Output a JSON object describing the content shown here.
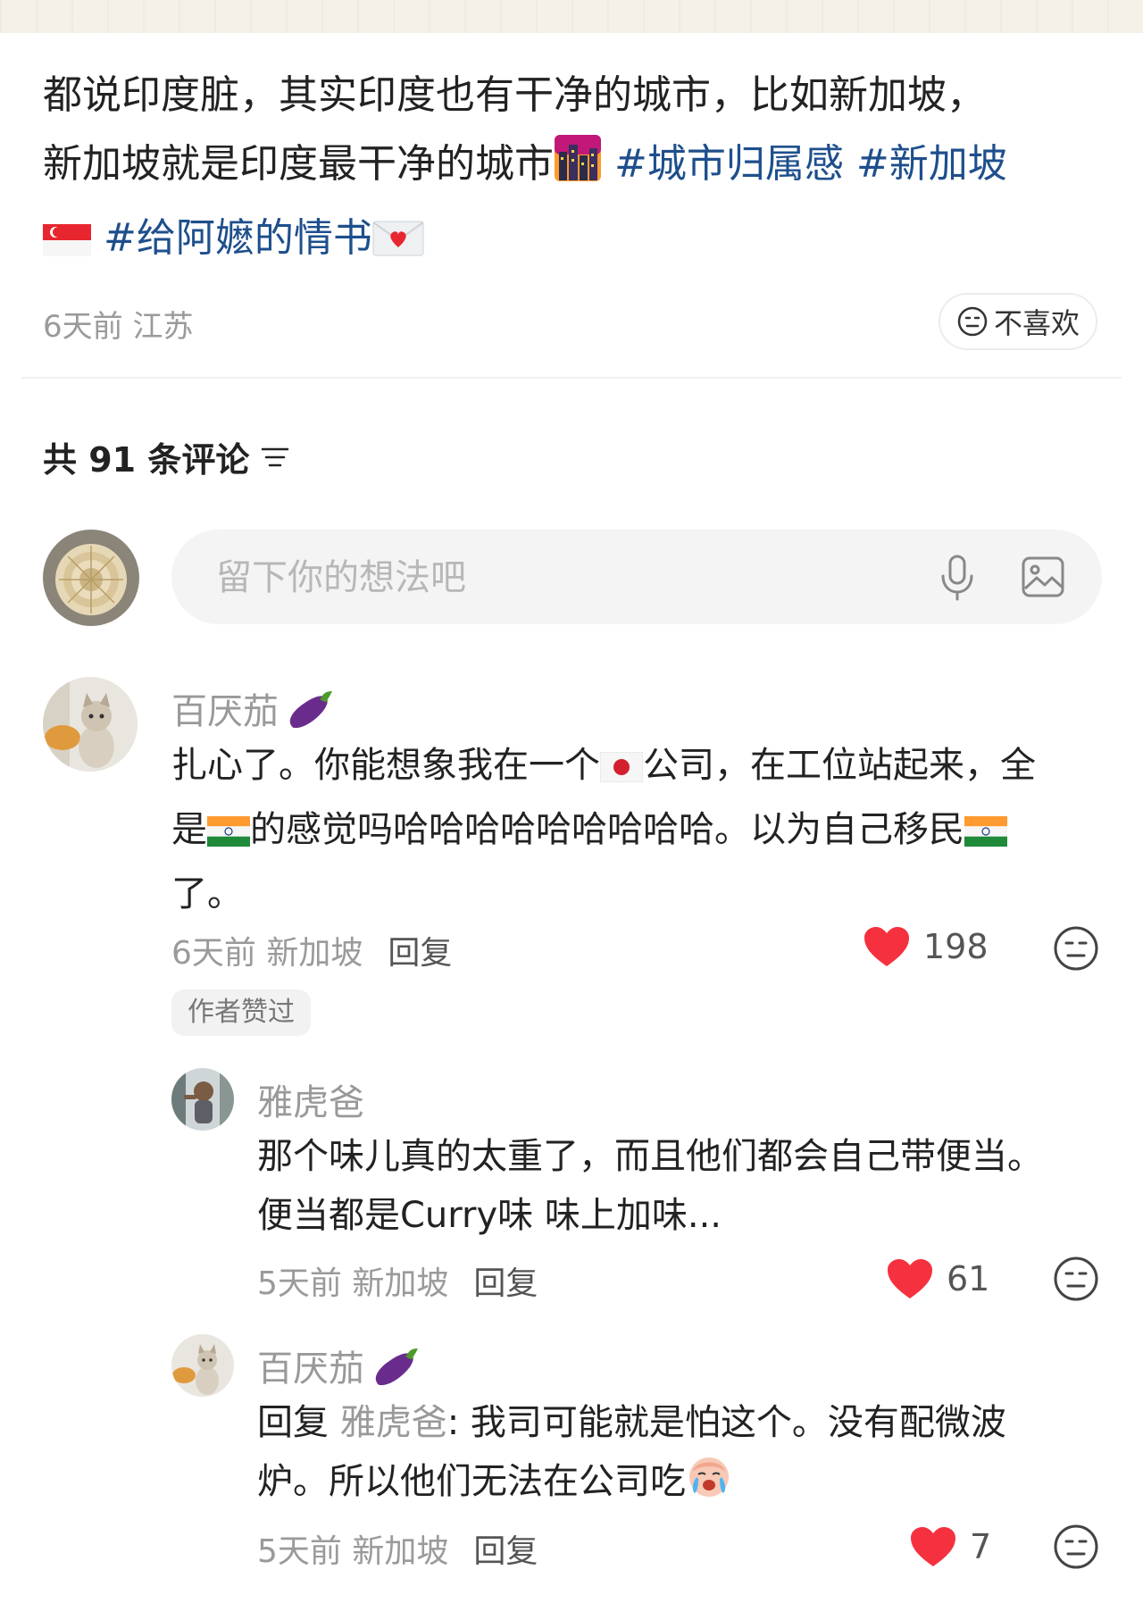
{
  "post": {
    "text_line1": "都说印度脏，其实印度也有干净的城市，比如新加坡，",
    "text_line2": "新加坡就是印度最干净的城市",
    "hashtags": [
      "#城市归属感",
      "#新加坡",
      "#给阿嬷的情书"
    ],
    "meta": "6天前 江苏",
    "dislike_label": "不喜欢"
  },
  "comments_header": {
    "count_label": "共 91 条评论"
  },
  "input": {
    "placeholder": "留下你的想法吧"
  },
  "comments": [
    {
      "username": "百厌茄",
      "text_a": "扎心了。你能想象我在一个",
      "text_b": "公司，在工位站起来，全",
      "text_c": "是",
      "text_d": "的感觉吗哈哈哈哈哈哈哈哈哈。以为自己移民",
      "text_e": "了。",
      "time_location": "6天前 新加坡",
      "reply_label": "回复",
      "likes": "198",
      "author_liked": "作者赞过"
    },
    {
      "username": "雅虎爸",
      "text_line1": "那个味儿真的太重了，而且他们都会自己带便当。",
      "text_line2": "便当都是Curry味 味上加味...",
      "time_location": "5天前 新加坡",
      "reply_label": "回复",
      "likes": "61"
    },
    {
      "username": "百厌茄",
      "reply_prefix": "回复",
      "reply_target": "雅虎爸",
      "text_line1": ": 我司可能就是怕这个。没有配微波",
      "text_line2": "炉。所以他们无法在公司吃",
      "time_location": "5天前 新加坡",
      "reply_label": "回复",
      "likes": "7"
    }
  ],
  "icons": {
    "city": "cityscape-dusk-icon",
    "sg_flag": "singapore-flag-icon",
    "love_letter": "love-letter-icon",
    "jp_flag": "japan-flag-icon",
    "in_flag": "india-flag-icon",
    "eggplant": "eggplant-icon",
    "crying": "crying-face-icon",
    "heart": "heart-icon",
    "neutral_face": "neutral-face-icon"
  },
  "colors": {
    "hashtag": "#1e4f8c",
    "heart": "#f5313f",
    "meta": "#9a9a9a"
  }
}
